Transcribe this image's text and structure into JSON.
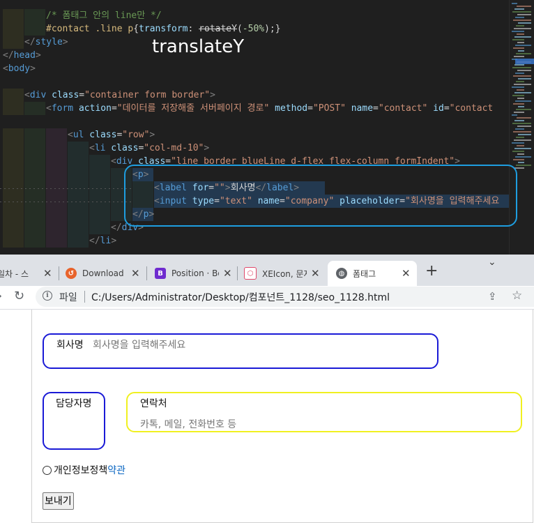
{
  "editor": {
    "lines": [
      {
        "indent": 2,
        "parts": [
          {
            "t": "/* 폼태그 안의 line만 */",
            "c": "c-com"
          }
        ]
      },
      {
        "indent": 2,
        "parts": [
          {
            "t": "#contact .line p",
            "c": "c-sel"
          },
          {
            "t": "{",
            "c": "c-txt"
          },
          {
            "t": "transform",
            "c": "c-prop"
          },
          {
            "t": ": ",
            "c": "c-txt"
          },
          {
            "t": "rotateY",
            "c": "c-strike"
          },
          {
            "t": "(",
            "c": "c-txt"
          },
          {
            "t": "-50%",
            "c": "c-num"
          },
          {
            "t": ");}",
            "c": "c-txt"
          }
        ]
      },
      {
        "indent": 1,
        "parts": [
          {
            "t": "</",
            "c": "c-brk"
          },
          {
            "t": "style",
            "c": "c-tag"
          },
          {
            "t": ">",
            "c": "c-brk"
          }
        ]
      },
      {
        "indent": 0,
        "parts": [
          {
            "t": "</",
            "c": "c-brk"
          },
          {
            "t": "head",
            "c": "c-tag"
          },
          {
            "t": ">",
            "c": "c-brk"
          }
        ]
      },
      {
        "indent": 0,
        "parts": [
          {
            "t": "<",
            "c": "c-brk"
          },
          {
            "t": "body",
            "c": "c-tag"
          },
          {
            "t": ">",
            "c": "c-brk"
          }
        ]
      },
      {
        "indent": 0,
        "parts": []
      },
      {
        "indent": 1,
        "parts": [
          {
            "t": "<",
            "c": "c-brk"
          },
          {
            "t": "div",
            "c": "c-tag"
          },
          {
            "t": " class",
            "c": "c-attr"
          },
          {
            "t": "=",
            "c": "c-txt"
          },
          {
            "t": "\"container form border\"",
            "c": "c-str"
          },
          {
            "t": ">",
            "c": "c-brk"
          }
        ]
      },
      {
        "indent": 2,
        "parts": [
          {
            "t": "<",
            "c": "c-brk"
          },
          {
            "t": "form",
            "c": "c-tag"
          },
          {
            "t": " action",
            "c": "c-attr"
          },
          {
            "t": "=",
            "c": "c-txt"
          },
          {
            "t": "\"데이터를 저장해줄 서버페이지 경로\"",
            "c": "c-str"
          },
          {
            "t": " method",
            "c": "c-attr"
          },
          {
            "t": "=",
            "c": "c-txt"
          },
          {
            "t": "\"POST\"",
            "c": "c-str"
          },
          {
            "t": " name",
            "c": "c-attr"
          },
          {
            "t": "=",
            "c": "c-txt"
          },
          {
            "t": "\"contact\"",
            "c": "c-str"
          },
          {
            "t": " id",
            "c": "c-attr"
          },
          {
            "t": "=",
            "c": "c-txt"
          },
          {
            "t": "\"contact",
            "c": "c-str"
          }
        ]
      },
      {
        "indent": 0,
        "parts": []
      },
      {
        "indent": 3,
        "parts": [
          {
            "t": "<",
            "c": "c-brk"
          },
          {
            "t": "ul",
            "c": "c-tag"
          },
          {
            "t": " class",
            "c": "c-attr"
          },
          {
            "t": "=",
            "c": "c-txt"
          },
          {
            "t": "\"row\"",
            "c": "c-str"
          },
          {
            "t": ">",
            "c": "c-brk"
          }
        ]
      },
      {
        "indent": 4,
        "parts": [
          {
            "t": "<",
            "c": "c-brk"
          },
          {
            "t": "li",
            "c": "c-tag"
          },
          {
            "t": " class",
            "c": "c-attr"
          },
          {
            "t": "=",
            "c": "c-txt"
          },
          {
            "t": "\"col-md-10\"",
            "c": "c-str"
          },
          {
            "t": ">",
            "c": "c-brk"
          }
        ]
      },
      {
        "indent": 5,
        "parts": [
          {
            "t": "<",
            "c": "c-brk"
          },
          {
            "t": "div",
            "c": "c-tag"
          },
          {
            "t": " class",
            "c": "c-attr"
          },
          {
            "t": "=",
            "c": "c-txt"
          },
          {
            "t": "\"line border blueLine d-flex flex-column formIndent\"",
            "c": "c-str"
          },
          {
            "t": ">",
            "c": "c-brk"
          }
        ]
      },
      {
        "indent": 6,
        "parts": [
          {
            "t": "<",
            "c": "c-brk"
          },
          {
            "t": "p",
            "c": "c-tag"
          },
          {
            "t": ">",
            "c": "c-brk"
          }
        ]
      },
      {
        "indent": 7,
        "parts": [
          {
            "t": "<",
            "c": "c-brk"
          },
          {
            "t": "label",
            "c": "c-tag"
          },
          {
            "t": " for",
            "c": "c-attr"
          },
          {
            "t": "=",
            "c": "c-txt"
          },
          {
            "t": "\"\"",
            "c": "c-str"
          },
          {
            "t": ">",
            "c": "c-brk"
          },
          {
            "t": "회사명",
            "c": "c-txt"
          },
          {
            "t": "</",
            "c": "c-brk"
          },
          {
            "t": "label",
            "c": "c-tag"
          },
          {
            "t": ">",
            "c": "c-brk"
          }
        ]
      },
      {
        "indent": 7,
        "parts": [
          {
            "t": "<",
            "c": "c-brk"
          },
          {
            "t": "input",
            "c": "c-tag"
          },
          {
            "t": " type",
            "c": "c-attr"
          },
          {
            "t": "=",
            "c": "c-txt"
          },
          {
            "t": "\"text\"",
            "c": "c-str"
          },
          {
            "t": " name",
            "c": "c-attr"
          },
          {
            "t": "=",
            "c": "c-txt"
          },
          {
            "t": "\"company\"",
            "c": "c-str"
          },
          {
            "t": " placeholder",
            "c": "c-attr"
          },
          {
            "t": "=",
            "c": "c-txt"
          },
          {
            "t": "\"회사명을 입력해주세요",
            "c": "c-str"
          }
        ]
      },
      {
        "indent": 6,
        "parts": [
          {
            "t": "</",
            "c": "c-brk"
          },
          {
            "t": "p",
            "c": "c-tag"
          },
          {
            "t": ">",
            "c": "c-brk"
          }
        ]
      },
      {
        "indent": 5,
        "parts": [
          {
            "t": "</",
            "c": "c-brk"
          },
          {
            "t": "div",
            "c": "c-tag"
          },
          {
            "t": ">",
            "c": "c-brk"
          }
        ]
      },
      {
        "indent": 4,
        "parts": [
          {
            "t": "</",
            "c": "c-brk"
          },
          {
            "t": "li",
            "c": "c-tag"
          },
          {
            "t": ">",
            "c": "c-brk"
          }
        ]
      }
    ],
    "annotation": "translateY"
  },
  "browser": {
    "tabs": [
      {
        "label": "일차 - 스",
        "icon": "",
        "active": false
      },
      {
        "label": "Download P",
        "icon": "download-site-icon",
        "active": false
      },
      {
        "label": "Position · Bo",
        "icon": "bootstrap-icon",
        "active": false
      },
      {
        "label": "XEIcon, 문자",
        "icon": "xeicon-icon",
        "active": false
      },
      {
        "label": "폼태그",
        "icon": "globe-icon",
        "active": true
      }
    ],
    "file_label": "파일",
    "url": "C:/Users/Administrator/Desktop/컴포넌트_1128/seo_1128.html"
  },
  "form": {
    "company_label": "회사명",
    "company_placeholder": "회사명을 입력해주세요",
    "manager_label": "담당자명",
    "contact_label": "연락처",
    "contact_placeholder": "카톡, 메일, 전화번호 등",
    "privacy_label": "개인정보정책",
    "terms_link": "약관",
    "submit_label": "보내기"
  },
  "colors": {
    "editor_bg": "#1f1f1f",
    "annotation_box": "#1e9ee0",
    "company_border": "#1a1ad6",
    "contact_border": "#f0f020",
    "link": "#0a66c2"
  }
}
